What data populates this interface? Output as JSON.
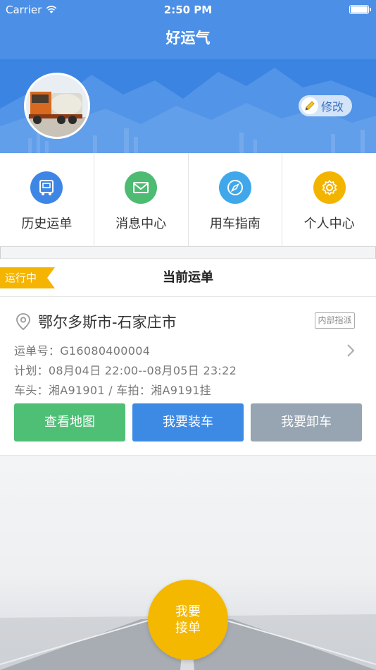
{
  "status_bar": {
    "carrier": "Carrier",
    "time": "2:50 PM"
  },
  "nav": {
    "title": "好运气"
  },
  "profile": {
    "edit_label": "修改"
  },
  "menu": [
    {
      "label": "历史运单",
      "icon": "truck-icon",
      "color": "#3d86e6"
    },
    {
      "label": "消息中心",
      "icon": "envelope-icon",
      "color": "#4dbb72"
    },
    {
      "label": "用车指南",
      "icon": "compass-icon",
      "color": "#40a8ea"
    },
    {
      "label": "个人中心",
      "icon": "gear-icon",
      "color": "#f3b400"
    }
  ],
  "current_order": {
    "status_tag": "运行中",
    "title": "当前运单",
    "route": "鄂尔多斯市-石家庄市",
    "badge": "内部指派",
    "order_no": "运单号：G16080400004",
    "plan": "计划：08月04日 22:00--08月05日 23:22",
    "vehicle": "车头：湘A91901  /  车拍：湘A9191挂",
    "buttons": {
      "map": "查看地图",
      "load": "我要装车",
      "unload": "我要卸车"
    }
  },
  "accept": {
    "line1": "我要",
    "line2": "接单"
  },
  "colors": {
    "primary": "#4b8fe6",
    "tag": "#f5b400",
    "green": "#4fbf76",
    "blue": "#3d8ae5",
    "gray": "#97a4b2"
  }
}
